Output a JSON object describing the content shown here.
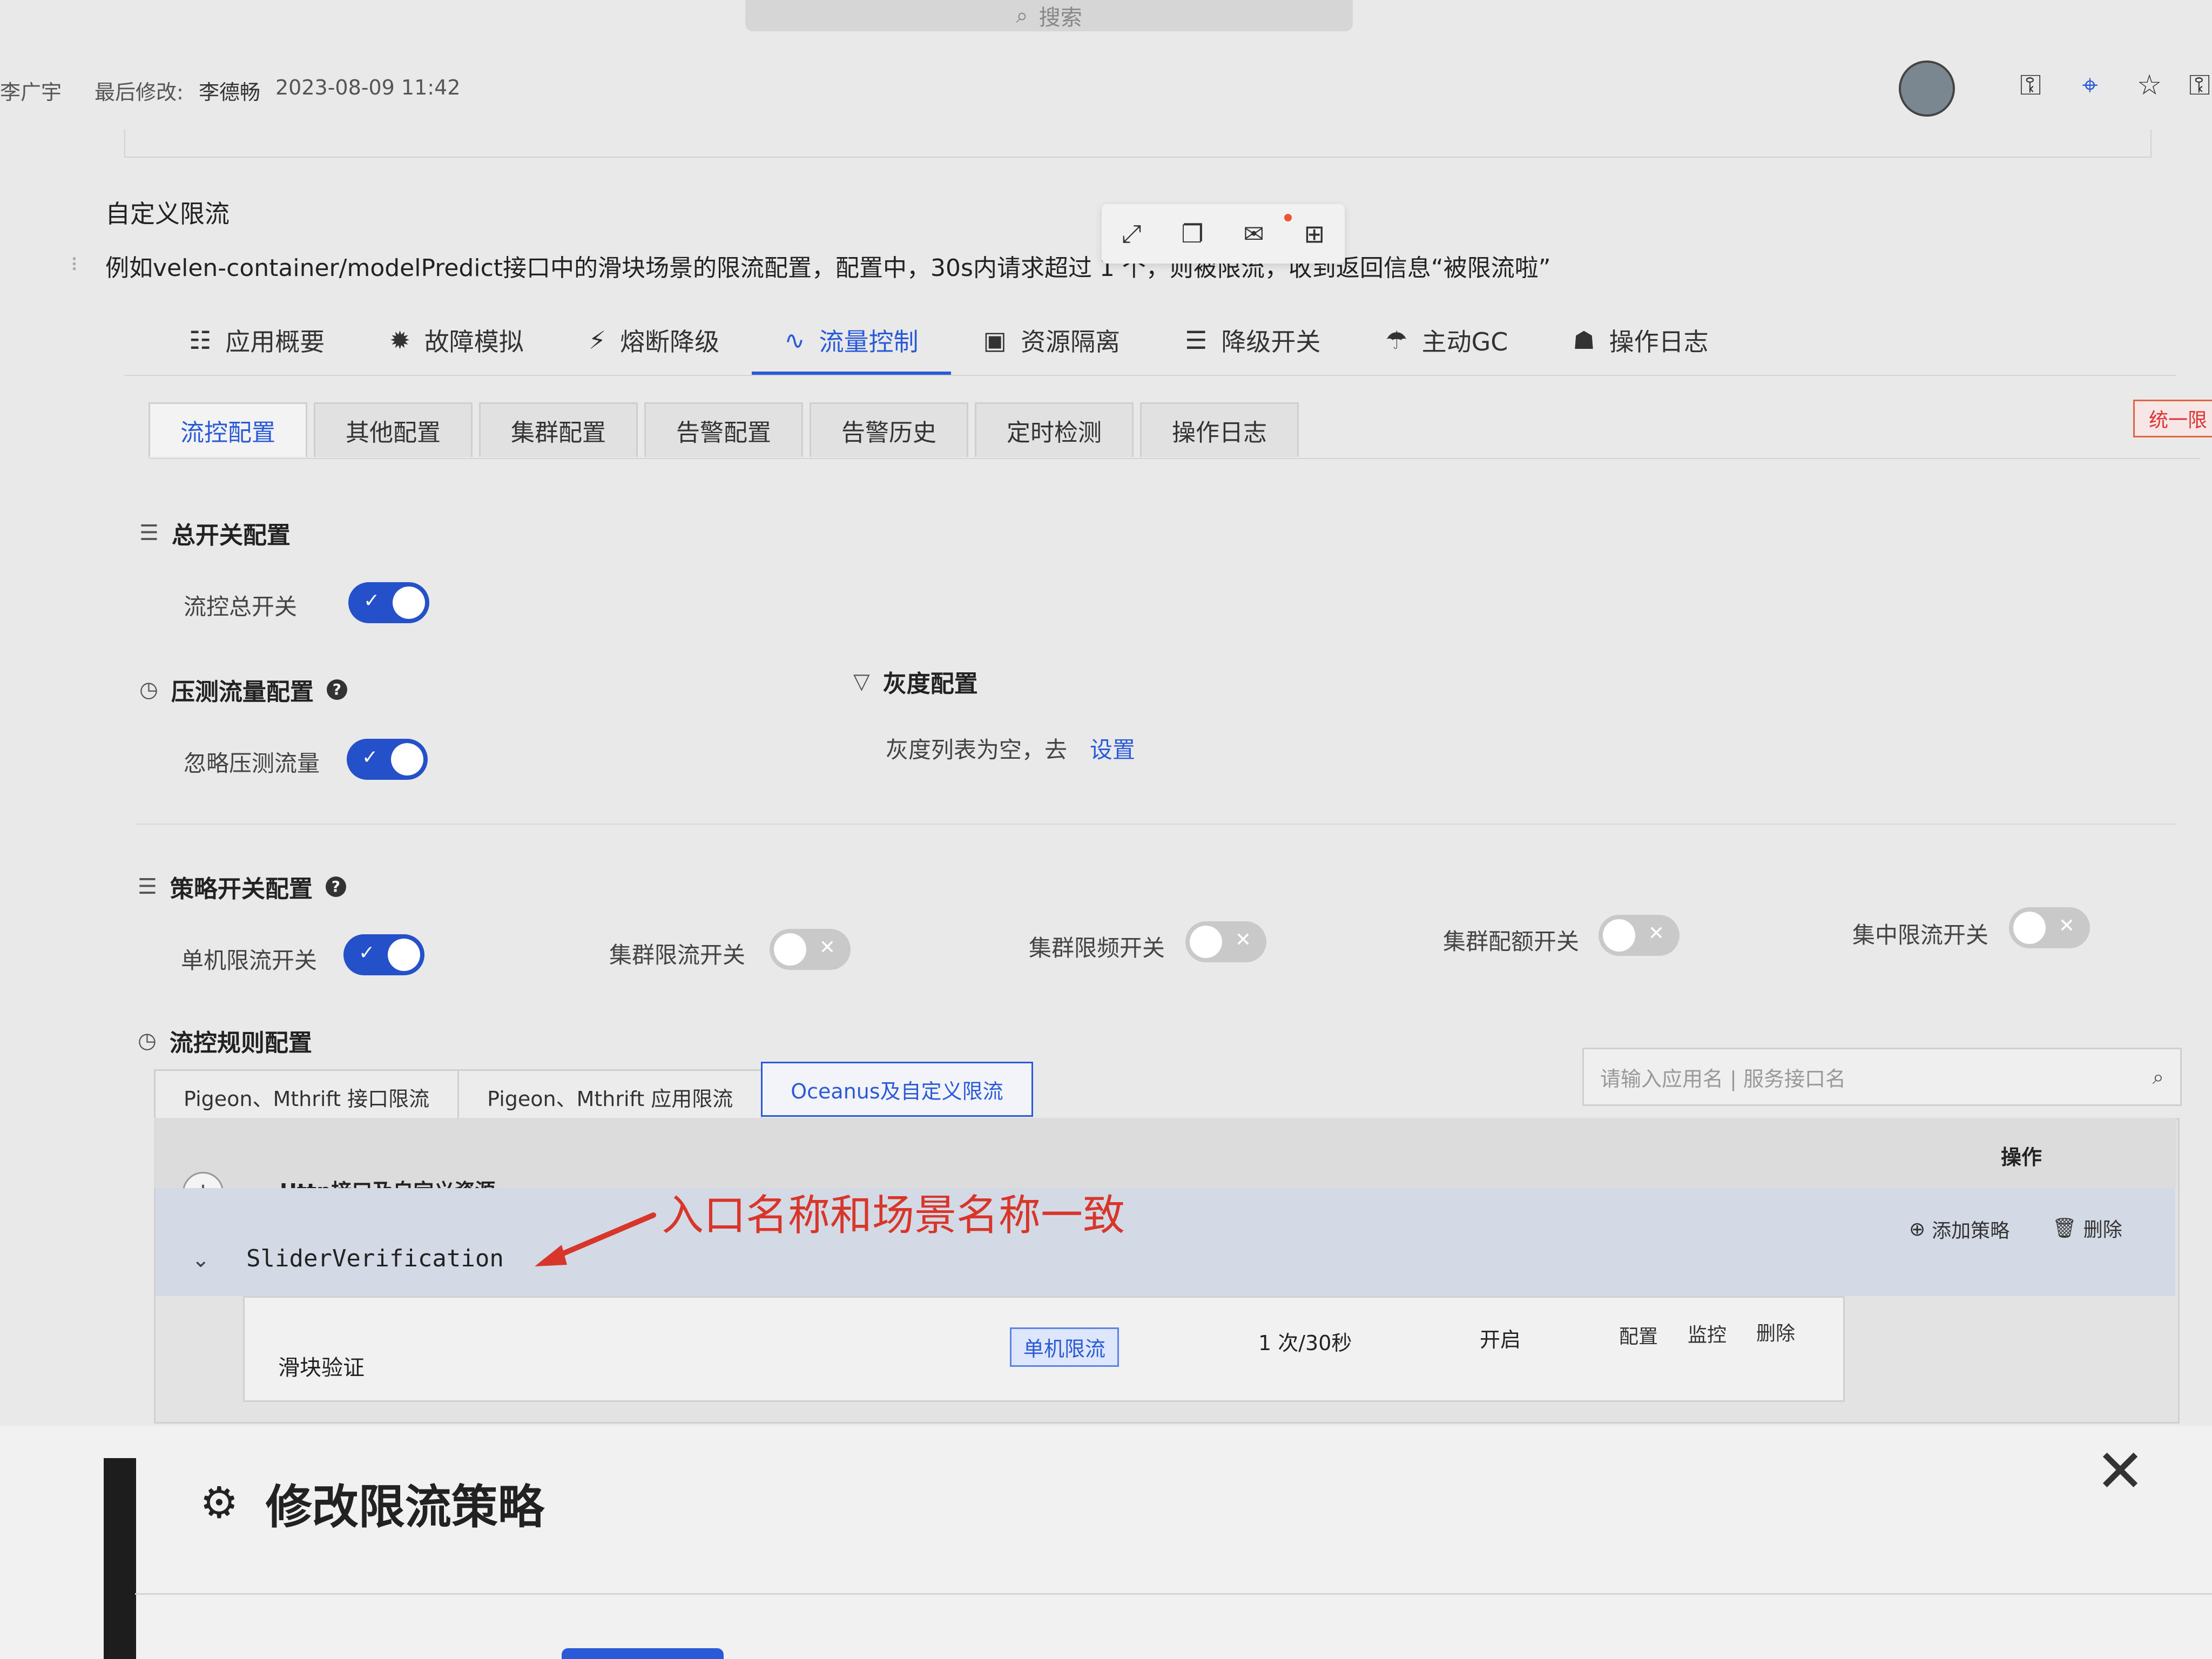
{
  "top_search": {
    "placeholder": "搜索"
  },
  "header": {
    "author_partial": "李广宇",
    "last_modified_label": "最后修改:",
    "last_modified_by": "李德畅",
    "last_modified_time": "2023-08-09 11:42"
  },
  "document": {
    "heading": "自定义限流",
    "description": "例如velen-container/modelPredict接口中的滑块场景的限流配置，配置中，30s内请求超过 1 个，则被限流，收到返回信息“被限流啦”"
  },
  "main_nav": [
    {
      "label": "应用概要",
      "icon": "grid-icon"
    },
    {
      "label": "故障模拟",
      "icon": "bug-icon"
    },
    {
      "label": "熔断降级",
      "icon": "fuse-icon"
    },
    {
      "label": "流量控制",
      "icon": "flow-icon",
      "active": true
    },
    {
      "label": "资源隔离",
      "icon": "box-icon"
    },
    {
      "label": "降级开关",
      "icon": "switch-icon"
    },
    {
      "label": "主动GC",
      "icon": "umbrella-icon"
    },
    {
      "label": "操作日志",
      "icon": "book-icon"
    }
  ],
  "corner_tag": "统一限",
  "sub_tabs": [
    "流控配置",
    "其他配置",
    "集群配置",
    "告警配置",
    "告警历史",
    "定时检测",
    "操作日志"
  ],
  "sections": {
    "master_switch": {
      "title": "总开关配置",
      "label": "流控总开关",
      "on": true
    },
    "stress_test": {
      "title": "压测流量配置",
      "label": "忽略压测流量",
      "on": true
    },
    "gray": {
      "title": "灰度配置",
      "empty_text": "灰度列表为空，去",
      "link": "设置"
    },
    "strategy": {
      "title": "策略开关配置",
      "switches": [
        {
          "label": "单机限流开关",
          "on": true
        },
        {
          "label": "集群限流开关",
          "on": false
        },
        {
          "label": "集群限频开关",
          "on": false
        },
        {
          "label": "集群配额开关",
          "on": false
        },
        {
          "label": "集中限流开关",
          "on": false
        }
      ]
    },
    "rules": {
      "title": "流控规则配置",
      "tabs": [
        "Pigeon、Mthrift 接口限流",
        "Pigeon、Mthrift 应用限流",
        "Oceanus及自定义限流"
      ],
      "search_placeholder": "请输入应用名 | 服务接口名"
    }
  },
  "table": {
    "header_resource": "Http接口及自定义资源",
    "header_action": "操作",
    "row": {
      "name": "SliderVerification",
      "add_policy": "添加策略",
      "delete": "删除",
      "sub": {
        "name": "滑块验证",
        "type": "单机限流",
        "rate": "1 次/30秒",
        "status": "开启",
        "actions": [
          "配置",
          "监控",
          "删除"
        ]
      }
    }
  },
  "annotation": "入口名称和场景名称一致",
  "dialog": {
    "title": "修改限流策略"
  }
}
